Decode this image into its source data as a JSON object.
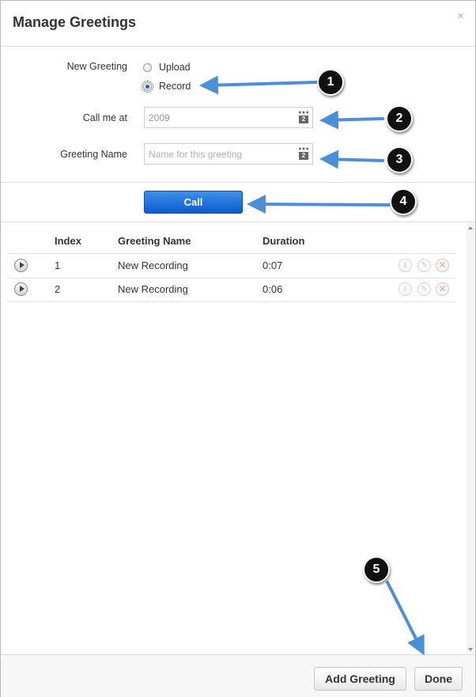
{
  "dialog": {
    "title": "Manage Greetings",
    "close_glyph": "×"
  },
  "form": {
    "new_greeting_label": "New Greeting",
    "options": [
      {
        "label": "Upload",
        "checked": false
      },
      {
        "label": "Record",
        "checked": true
      }
    ],
    "call_me_label": "Call me at",
    "call_me_value": "2009",
    "greeting_name_label": "Greeting Name",
    "greeting_name_placeholder": "Name for this greeting",
    "field_icon": "calendar-icon",
    "field_icon_number": "2"
  },
  "call_button": {
    "label": "Call",
    "color": "#1566d6"
  },
  "table": {
    "headers": [
      "Index",
      "Greeting Name",
      "Duration"
    ],
    "rows": [
      {
        "index": "1",
        "name": "New Recording",
        "duration": "0:07"
      },
      {
        "index": "2",
        "name": "New Recording",
        "duration": "0:06"
      }
    ],
    "row_actions": [
      "download-icon",
      "edit-icon",
      "delete-icon"
    ]
  },
  "footer": {
    "add_label": "Add Greeting",
    "done_label": "Done"
  },
  "annotations": {
    "badges": [
      "1",
      "2",
      "3",
      "4",
      "5"
    ],
    "arrow_color": "#4a8fd8"
  }
}
